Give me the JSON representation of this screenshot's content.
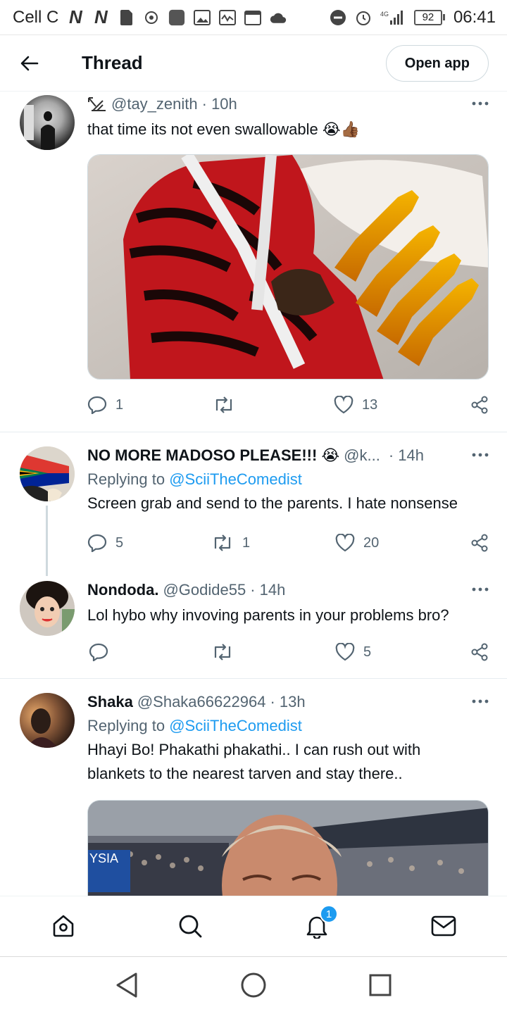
{
  "status_bar": {
    "carrier": "Cell C",
    "network": "4G",
    "battery": "92",
    "time": "06:41"
  },
  "header": {
    "title": "Thread",
    "open_app_label": "Open app"
  },
  "tweets": [
    {
      "handle": "@tay_zenith",
      "time": "· 10h",
      "text": "that time its not even swallowable 😭👍🏾",
      "replies": "1",
      "retweets": "",
      "likes": "13"
    },
    {
      "name": "NO MORE MADOSO PLEASE!!! 😭",
      "handle": "@k...",
      "time": "· 14h",
      "replying_prefix": "Replying to",
      "replying_to": "@SciiTheComedist",
      "text": "Screen grab and send to the parents. I hate nonsense",
      "replies": "5",
      "retweets": "1",
      "likes": "20"
    },
    {
      "name": "Nondoda.",
      "handle": "@Godide55",
      "time": "· 14h",
      "text": "Lol hybo why invoving parents in your problems bro?",
      "replies": "",
      "retweets": "",
      "likes": "5"
    },
    {
      "name": "Shaka",
      "handle": "@Shaka66622964",
      "time": "· 13h",
      "replying_prefix": "Replying to",
      "replying_to": "@SciiTheComedist",
      "text": "Hhayi Bo! Phakathi phakathi.. I can rush out with blankets to the nearest tarven and stay there.."
    }
  ],
  "bottom_nav": {
    "notifications_badge": "1"
  },
  "colors": {
    "accent": "#1d9bf0",
    "text_primary": "#0f1419",
    "text_secondary": "#536471"
  }
}
